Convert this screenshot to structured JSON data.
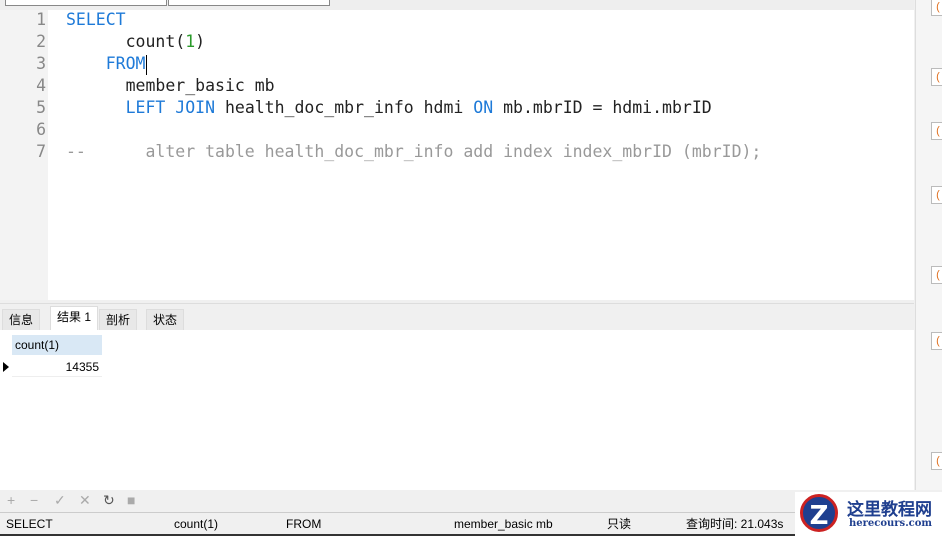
{
  "editor": {
    "line_numbers": [
      "1",
      "2",
      "3",
      "4",
      "5",
      "6",
      "7"
    ],
    "lines": [
      [
        {
          "t": "SELECT",
          "c": "kw"
        }
      ],
      [
        {
          "t": "      count(",
          "c": ""
        },
        {
          "t": "1",
          "c": "num"
        },
        {
          "t": ")",
          "c": ""
        }
      ],
      [
        {
          "t": "    FROM",
          "c": "kw"
        }
      ],
      [
        {
          "t": "      member_basic mb",
          "c": ""
        }
      ],
      [
        {
          "t": "      ",
          "c": ""
        },
        {
          "t": "LEFT JOIN",
          "c": "kw"
        },
        {
          "t": " health_doc_mbr_info hdmi ",
          "c": ""
        },
        {
          "t": "ON",
          "c": "kw"
        },
        {
          "t": " mb.mbrID = hdmi.mbrID",
          "c": ""
        }
      ],
      [],
      [
        {
          "t": "--      alter table health_doc_mbr_info add index index_mbrID (mbrID);",
          "c": "cm"
        }
      ]
    ]
  },
  "tabs": [
    "信息",
    "结果 1",
    "剖析",
    "状态"
  ],
  "results": {
    "column": "count(1)",
    "value": "14355"
  },
  "toolbar": [
    "+",
    "−",
    "✓",
    "✕",
    "↻",
    "■"
  ],
  "status": {
    "s1": "SELECT",
    "s2": "count(1)",
    "s3": "FROM",
    "s4": "member_basic mb",
    "readonly": "只读",
    "time": "查询时间: 21.043s"
  },
  "logo": {
    "title": "这里教程网",
    "url": "herecours.com"
  }
}
